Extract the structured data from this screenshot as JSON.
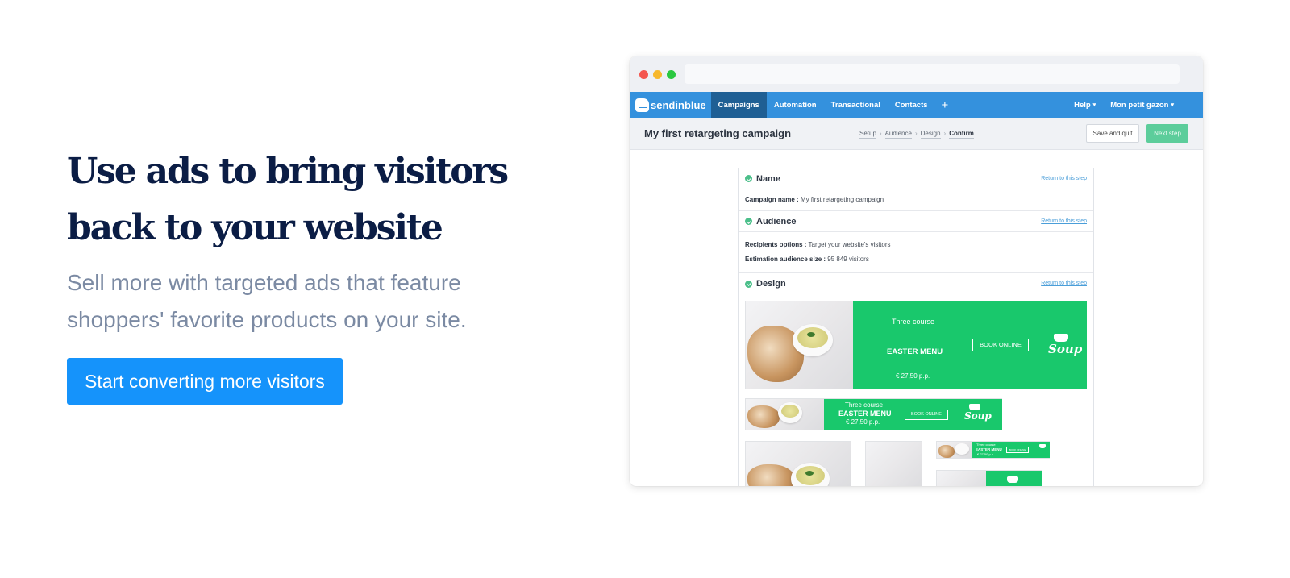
{
  "hero": {
    "title": "Use ads to bring visitors back to your website",
    "subtitle": "Sell more with targeted ads that feature shoppers' favorite products on your site.",
    "cta_label": "Start converting more visitors"
  },
  "app": {
    "logo_text": "sendinblue",
    "nav": {
      "items": [
        {
          "label": "Campaigns",
          "active": true
        },
        {
          "label": "Automation",
          "active": false
        },
        {
          "label": "Transactional",
          "active": false
        },
        {
          "label": "Contacts",
          "active": false
        }
      ],
      "plus": "+",
      "help_label": "Help",
      "account_label": "Mon petit gazon",
      "caret": "▾"
    },
    "subheader": {
      "title": "My first retargeting campaign",
      "breadcrumb": [
        "Setup",
        "Audience",
        "Design",
        "Confirm"
      ],
      "breadcrumb_sep": "›",
      "save_label": "Save and quit",
      "next_label": "Next step"
    },
    "sections": {
      "name": {
        "title": "Name",
        "return_link": "Return to this step",
        "fields": [
          {
            "label": "Campaign name :",
            "value": "My first retargeting campaign"
          }
        ]
      },
      "audience": {
        "title": "Audience",
        "return_link": "Return to this step",
        "fields": [
          {
            "label": "Recipients options :",
            "value": "Target your website's visitors"
          },
          {
            "label": "Estimation audience size :",
            "value": "95 849 visitors"
          }
        ]
      },
      "design": {
        "title": "Design",
        "return_link": "Return to this step"
      }
    },
    "ad": {
      "line1": "Three course",
      "line2": "EASTER MENU",
      "price": "€ 27,50 p.p.",
      "button": "BOOK ONLINE",
      "brand": "Soup"
    }
  },
  "colors": {
    "hero_title": "#0b1d45",
    "hero_sub": "#7b8aa3",
    "cta": "#1593fb",
    "nav": "#3491dd",
    "nav_active": "#1f5f94",
    "ad_green": "#19c86c",
    "next_step": "#5ccd9b"
  }
}
